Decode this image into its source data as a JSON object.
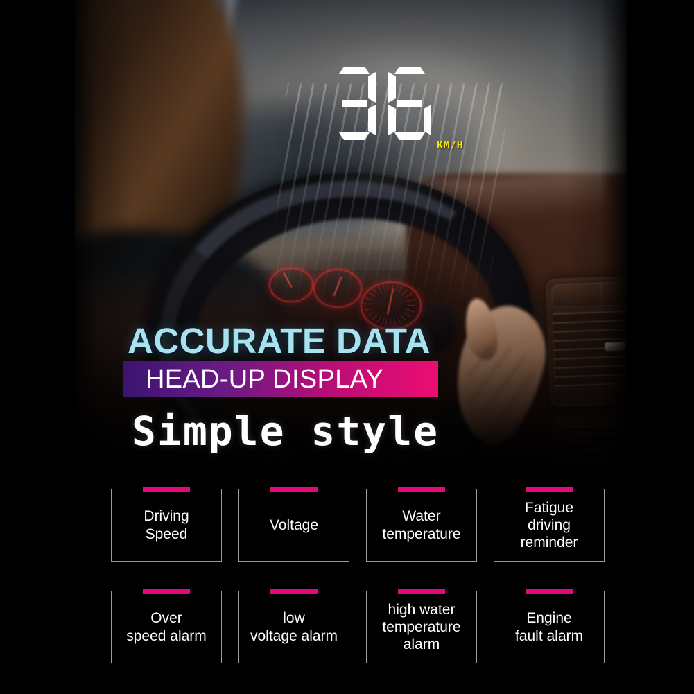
{
  "hud": {
    "speed_value": "36",
    "speed_digits": [
      "3",
      "6"
    ],
    "unit_label": "KM/H",
    "unit_color": "#f5e400",
    "digit_color": "#ffffff"
  },
  "headline": {
    "line1": "ACCURATE DATA",
    "line1_color": "#a6e2f0",
    "line2": "HEAD-UP DISPLAY",
    "line2_color": "#ffffff",
    "line2_bar_gradient_start": "#3b1470",
    "line2_bar_gradient_end": "#ec0d72",
    "tagline": "Simple style",
    "tagline_color": "#ffffff"
  },
  "theme": {
    "accent_pink": "#e6077c",
    "box_border": "#9a9a9a",
    "background": "#000000"
  },
  "features": [
    {
      "label": "Driving\nSpeed"
    },
    {
      "label": "Voltage"
    },
    {
      "label": "Water\ntemperature"
    },
    {
      "label": "Fatigue\ndriving\nreminder"
    },
    {
      "label": "Over\nspeed alarm"
    },
    {
      "label": "low\nvoltage alarm"
    },
    {
      "label": "high water\ntemperature\nalarm"
    },
    {
      "label": "Engine\nfault alarm"
    }
  ]
}
